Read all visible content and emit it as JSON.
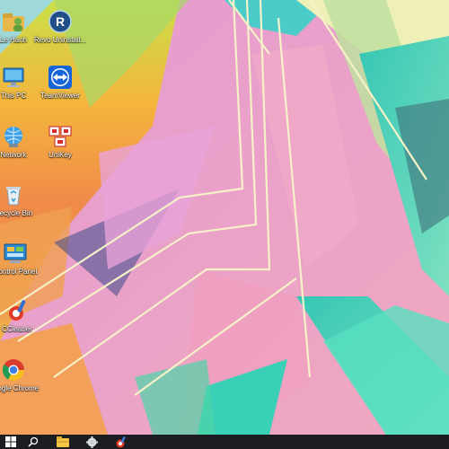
{
  "desktop": {
    "icons": [
      {
        "label": "Le Hanh",
        "icon": "user-folder-icon"
      },
      {
        "label": "This PC",
        "icon": "computer-icon"
      },
      {
        "label": "Network",
        "icon": "network-icon"
      },
      {
        "label": "Recycle Bin",
        "icon": "recycle-bin-icon"
      },
      {
        "label": "Control Panel",
        "icon": "control-panel-icon"
      },
      {
        "label": "CCleaner",
        "icon": "ccleaner-icon"
      },
      {
        "label": "Google Chrome",
        "icon": "chrome-icon"
      },
      {
        "label": "Revo Uninstall...",
        "icon": "revo-uninstaller-icon"
      },
      {
        "label": "TeamViewer",
        "icon": "teamviewer-icon"
      },
      {
        "label": "UniKey",
        "icon": "unikey-icon"
      }
    ]
  },
  "taskbar": {
    "items": [
      "start-icon",
      "search-icon",
      "file-explorer-icon",
      "settings-icon",
      "ccleaner-icon"
    ]
  },
  "colors": {
    "taskbar": "#1b1d22",
    "wallpaper_pink": "#e9a0c8",
    "wallpaper_teal": "#3fd6b3",
    "wallpaper_orange": "#f3a13c"
  }
}
